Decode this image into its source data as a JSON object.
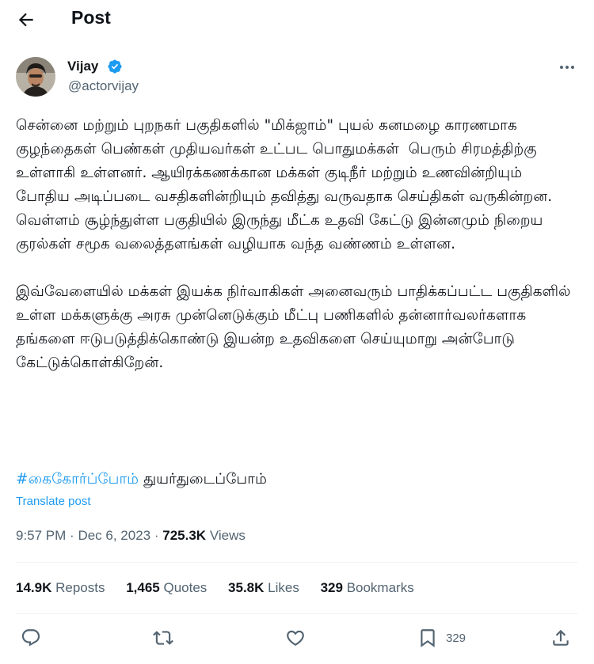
{
  "header": {
    "title": "Post"
  },
  "author": {
    "name": "Vijay",
    "handle": "@actorvijay"
  },
  "tweet": {
    "paragraph1": "சென்னை மற்றும் புறநகர் பகுதிகளில் \"மிக்ஜாம்\" புயல் கனமழை காரணமாக குழந்தைகள் பெண்கள் முதியவர்கள் உட்பட பொதுமக்கள்  பெரும் சிரமத்திற்கு உள்ளாகி உள்ளனர். ஆயிரக்கணக்கான மக்கள் குடிநீர் மற்றும் உணவின்றியும் போதிய அடிப்படை வசதிகளின்றியும் தவித்து வருவதாக செய்திகள் வருகின்றன. வெள்ளம் சூழ்ந்துள்ள பகுதியில் இருந்து மீட்க உதவி கேட்டு இன்னமும் நிறைய குரல்கள் சமூக வலைத்தளங்கள் வழியாக வந்த வண்ணம் உள்ளன.",
    "paragraph2": "இவ்வேளையில் மக்கள் இயக்க நிர்வாகிகள் அனைவரும் பாதிக்கப்பட்ட பகுதிகளில் உள்ள மக்களுக்கு அரசு முன்னெடுக்கும் மீட்பு பணிகளில் தன்னார்வலர்களாக தங்களை ஈடுபடுத்திக்கொண்டு இயன்ற உதவிகளை செய்யுமாறு அன்போடு கேட்டுக்கொள்கிறேன்.",
    "hashtag": "#கைகோர்ப்போம்",
    "hashtag_suffix": " துயர்துடைப்போம்",
    "translate": "Translate post"
  },
  "meta": {
    "time": "9:57 PM",
    "date": "Dec 6, 2023",
    "views_count": "725.3K",
    "views_label": "Views"
  },
  "stats": {
    "reposts_count": "14.9K",
    "reposts_label": "Reposts",
    "quotes_count": "1,465",
    "quotes_label": "Quotes",
    "likes_count": "35.8K",
    "likes_label": "Likes",
    "bookmarks_count": "329",
    "bookmarks_label": "Bookmarks"
  },
  "actions": {
    "bookmark_count": "329"
  },
  "icons": [
    "back-arrow-icon",
    "verified-badge-icon",
    "more-icon",
    "reply-icon",
    "repost-icon",
    "like-icon",
    "bookmark-icon",
    "share-icon"
  ],
  "colors": {
    "accent": "#1d9bf0",
    "secondary_text": "#536471",
    "divider": "#eff3f4"
  }
}
